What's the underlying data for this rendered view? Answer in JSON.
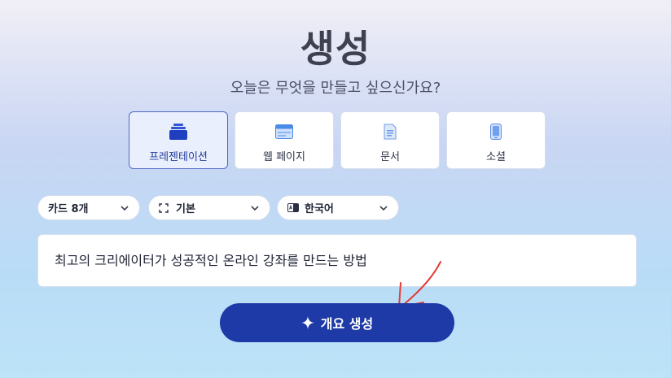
{
  "header": {
    "title": "생성",
    "subtitle": "오늘은 무엇을 만들고 싶으신가요?"
  },
  "content_types": [
    {
      "label": "프레젠테이션",
      "icon": "presentation-icon",
      "selected": true
    },
    {
      "label": "웹 페이지",
      "icon": "webpage-icon",
      "selected": false
    },
    {
      "label": "문서",
      "icon": "document-icon",
      "selected": false
    },
    {
      "label": "소셜",
      "icon": "social-phone-icon",
      "selected": false
    }
  ],
  "options": {
    "card_count": {
      "label": "카드 8개",
      "icon": "card-stack-icon"
    },
    "layout": {
      "label": "기본",
      "icon": "frame-icon"
    },
    "language": {
      "label": "한국어",
      "icon": "language-icon"
    }
  },
  "prompt": {
    "value": "최고의 크리에이터가 성공적인 온라인 강좌를 만드는 방법"
  },
  "generate_button": {
    "label": "개요 생성",
    "icon": "sparkle-icon"
  },
  "colors": {
    "accent": "#1d3aa6",
    "selected_border": "#4f68c4",
    "annotation_arrow": "#e53935"
  }
}
